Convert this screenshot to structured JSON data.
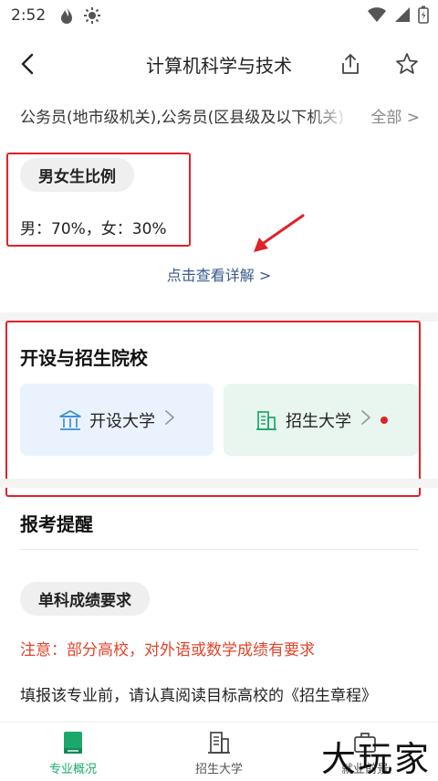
{
  "status_bar": {
    "time": "2:52"
  },
  "nav": {
    "title": "计算机科学与技术"
  },
  "jobs": {
    "text": "公务员(地市级机关),公务员(区县级及以下机关)",
    "all_label": "全部 >"
  },
  "gender": {
    "pill_label": "男女生比例",
    "ratio_text": "男：70%，女：30%",
    "detail_link": "点击查看详解 >"
  },
  "schools": {
    "title": "开设与招生院校",
    "open_label": "开设大学",
    "recruit_label": "招生大学"
  },
  "reminder": {
    "title": "报考提醒",
    "req_pill": "单科成绩要求",
    "notice": "注意：部分高校，对外语或数学成绩有要求",
    "fill_text": "填报该专业前，请认真阅读目标高校的《招生章程》"
  },
  "tabs": [
    {
      "label": "专业概况",
      "icon": "book-icon",
      "active": true
    },
    {
      "label": "招生大学",
      "icon": "building-icon",
      "active": false
    },
    {
      "label": "就业前景",
      "icon": "briefcase-icon",
      "active": false
    }
  ],
  "watermark": "大玩家",
  "colors": {
    "accent": "#1aa96b",
    "annotation_red": "#e0222a",
    "notice": "#e0442a",
    "link": "#3a5a8c"
  }
}
